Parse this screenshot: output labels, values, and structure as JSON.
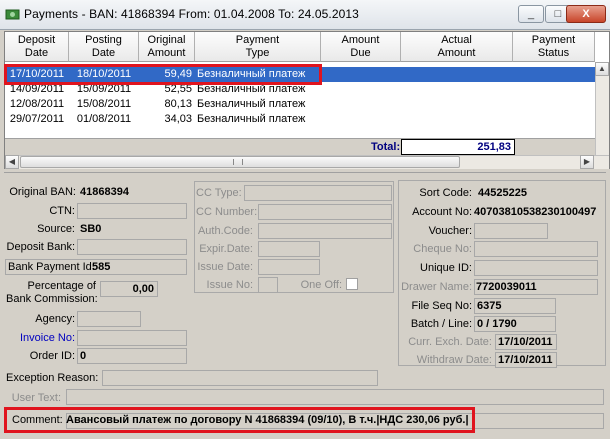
{
  "window": {
    "title": "Payments - BAN: 41868394   From: 01.04.2008   To: 24.05.2013",
    "minimize": "_",
    "maximize": "□",
    "close": "X"
  },
  "grid": {
    "columns": [
      "Deposit\nDate",
      "Posting\nDate",
      "Original\nAmount",
      "Payment\nType",
      "Amount\nDue",
      "Actual\nAmount",
      "Payment\nStatus"
    ],
    "rows": [
      {
        "deposit": "17/10/2011",
        "posting": "18/10/2011",
        "amount": "59,49",
        "type": "Безналичный платеж",
        "selected": true
      },
      {
        "deposit": "14/09/2011",
        "posting": "15/09/2011",
        "amount": "52,55",
        "type": "Безналичный платеж",
        "selected": false
      },
      {
        "deposit": "12/08/2011",
        "posting": "15/08/2011",
        "amount": "80,13",
        "type": "Безналичный платеж",
        "selected": false
      },
      {
        "deposit": "29/07/2011",
        "posting": "01/08/2011",
        "amount": "34,03",
        "type": "Безналичный платеж",
        "selected": false
      }
    ],
    "total_label": "Total:",
    "total_value": "251,83"
  },
  "left": {
    "original_ban_label": "Original BAN:",
    "original_ban": "41868394",
    "ctn_label": "CTN:",
    "ctn": "",
    "source_label": "Source:",
    "source": "SB0",
    "deposit_bank_label": "Deposit Bank:",
    "deposit_bank": "",
    "bank_payment_id_label": "Bank Payment Id:",
    "bank_payment_id": "585",
    "percentage_label_1": "Percentage of",
    "percentage_label_2": "Bank Commission:",
    "percentage": "0,00",
    "agency_label": "Agency:",
    "invoice_label": "Invoice No:",
    "order_label": "Order ID:",
    "order_id": "0"
  },
  "middle": {
    "cc_type_label": "CC Type:",
    "cc_number_label": "CC Number:",
    "auth_code_label": "Auth.Code:",
    "expir_label": "Expir.Date:",
    "issue_date_label": "Issue Date:",
    "issue_no_label": "Issue No:",
    "one_off_label": "One Off:"
  },
  "right": {
    "sort_code_label": "Sort Code:",
    "sort_code": "44525225",
    "account_label": "Account No:",
    "account": "40703810538230100497",
    "voucher_label": "Voucher:",
    "cheque_label": "Cheque No:",
    "unique_label": "Unique ID:",
    "drawer_label": "Drawer Name:",
    "drawer": "7720039011",
    "file_seq_label": "File Seq No:",
    "file_seq": "6375",
    "batch_label": "Batch / Line:",
    "batch": "0 / 1790",
    "curr_exch_label": "Curr. Exch. Date:",
    "curr_exch": "17/10/2011",
    "withdraw_label": "Withdraw Date:",
    "withdraw": "17/10/2011"
  },
  "bottom": {
    "exception_label": "Exception Reason:",
    "user_text_label": "User Text:",
    "comment_label": "Comment:",
    "comment": "Авансовый платеж по договору N 41868394 (09/10), В т.ч.|НДС 230,06 руб.|"
  }
}
